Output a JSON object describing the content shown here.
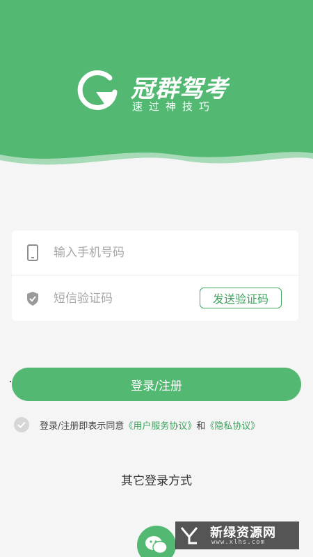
{
  "header": {
    "brand_title": "冠群驾考",
    "brand_subtitle": "速过神技巧",
    "logo_icon": "g-logo-icon",
    "background_color": "#52b872"
  },
  "form": {
    "phone_placeholder": "输入手机号码",
    "phone_value": "",
    "phone_icon": "phone-icon",
    "code_placeholder": "短信验证码",
    "code_value": "",
    "code_icon": "shield-icon",
    "send_code_label": "发送验证码"
  },
  "login_button": {
    "label": "登录/注册",
    "color": "#52b872"
  },
  "agreement": {
    "prefix": "登录/注册即表示同意",
    "user_agreement_link": "《用户服务协议》",
    "connector": "和",
    "privacy_link": "《隐私协议》",
    "link_color": "#3fa35f",
    "checked": false
  },
  "other_login": {
    "title": "其它登录方式",
    "wechat_icon": "wechat-icon"
  },
  "watermark": {
    "title": "新绿资源网",
    "url": "www.xlhs.com"
  }
}
